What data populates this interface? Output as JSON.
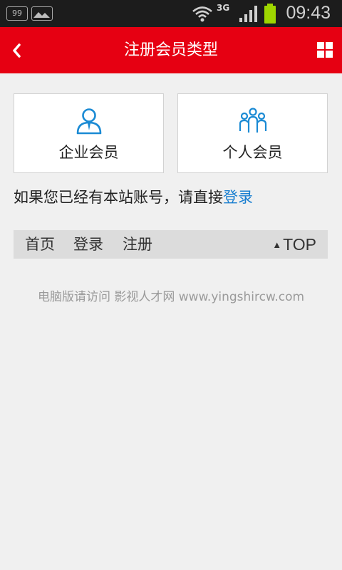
{
  "status_bar": {
    "notif_count": "99",
    "network": "3G",
    "time": "09:43",
    "icons": [
      "notification-count-icon",
      "image-icon",
      "wifi-icon",
      "signal-icon",
      "battery-icon"
    ]
  },
  "app_bar": {
    "title": "注册会员类型",
    "back_icon": "chevron-left-icon",
    "menu_icon": "grid-icon",
    "color": "#e60012"
  },
  "member_types": [
    {
      "label": "企业会员",
      "icon": "business-user-icon"
    },
    {
      "label": "个人会员",
      "icon": "people-group-icon"
    }
  ],
  "login_hint": {
    "text": "如果您已经有本站账号，请直接",
    "link": "登录",
    "link_color": "#1a7fd0"
  },
  "footer_nav": {
    "home": "首页",
    "login": "登录",
    "register": "注册",
    "top_arrow": "▲",
    "top": "TOP"
  },
  "pc_note": "电脑版请访问  影视人才网 www.yingshircw.com"
}
